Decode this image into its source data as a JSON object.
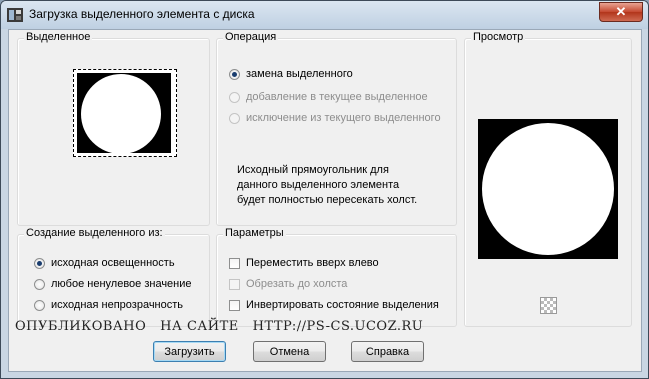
{
  "window": {
    "title": "Загрузка выделенного элемента с диска",
    "close_label": "✕"
  },
  "selection_group": {
    "legend": "Выделенное"
  },
  "operation_group": {
    "legend": "Операция",
    "options": [
      {
        "label": "замена выделенного",
        "selected": true,
        "enabled": true
      },
      {
        "label": "добавление в текущее выделенное",
        "selected": false,
        "enabled": false
      },
      {
        "label": "исключение из текущего выделенного",
        "selected": false,
        "enabled": false
      }
    ],
    "info": [
      "Исходный прямоугольник для",
      "данного выделенного элемента",
      "будет полностью пересекать холст."
    ]
  },
  "preview_group": {
    "legend": "Просмотр"
  },
  "create_from_group": {
    "legend": "Создание выделенного из:",
    "options": [
      {
        "label": "исходная освещенность",
        "selected": true
      },
      {
        "label": "любое ненулевое значение",
        "selected": false
      },
      {
        "label": "исходная непрозрачность",
        "selected": false
      }
    ]
  },
  "params_group": {
    "legend": "Параметры",
    "options": [
      {
        "label": "Переместить вверх влево",
        "checked": false,
        "enabled": true
      },
      {
        "label": "Обрезать до холста",
        "checked": false,
        "enabled": false
      },
      {
        "label": "Инвертировать состояние выделения",
        "checked": false,
        "enabled": true
      }
    ]
  },
  "watermark": "ОПУБЛИКОВАНО   НА САЙТЕ   HTTP://PS-CS.UCOZ.RU",
  "buttons": {
    "load": "Загрузить",
    "cancel": "Отмена",
    "help": "Справка"
  },
  "icons": {
    "app": "photoshop-app-icon",
    "transparency": "transparency-checkerboard-icon"
  }
}
